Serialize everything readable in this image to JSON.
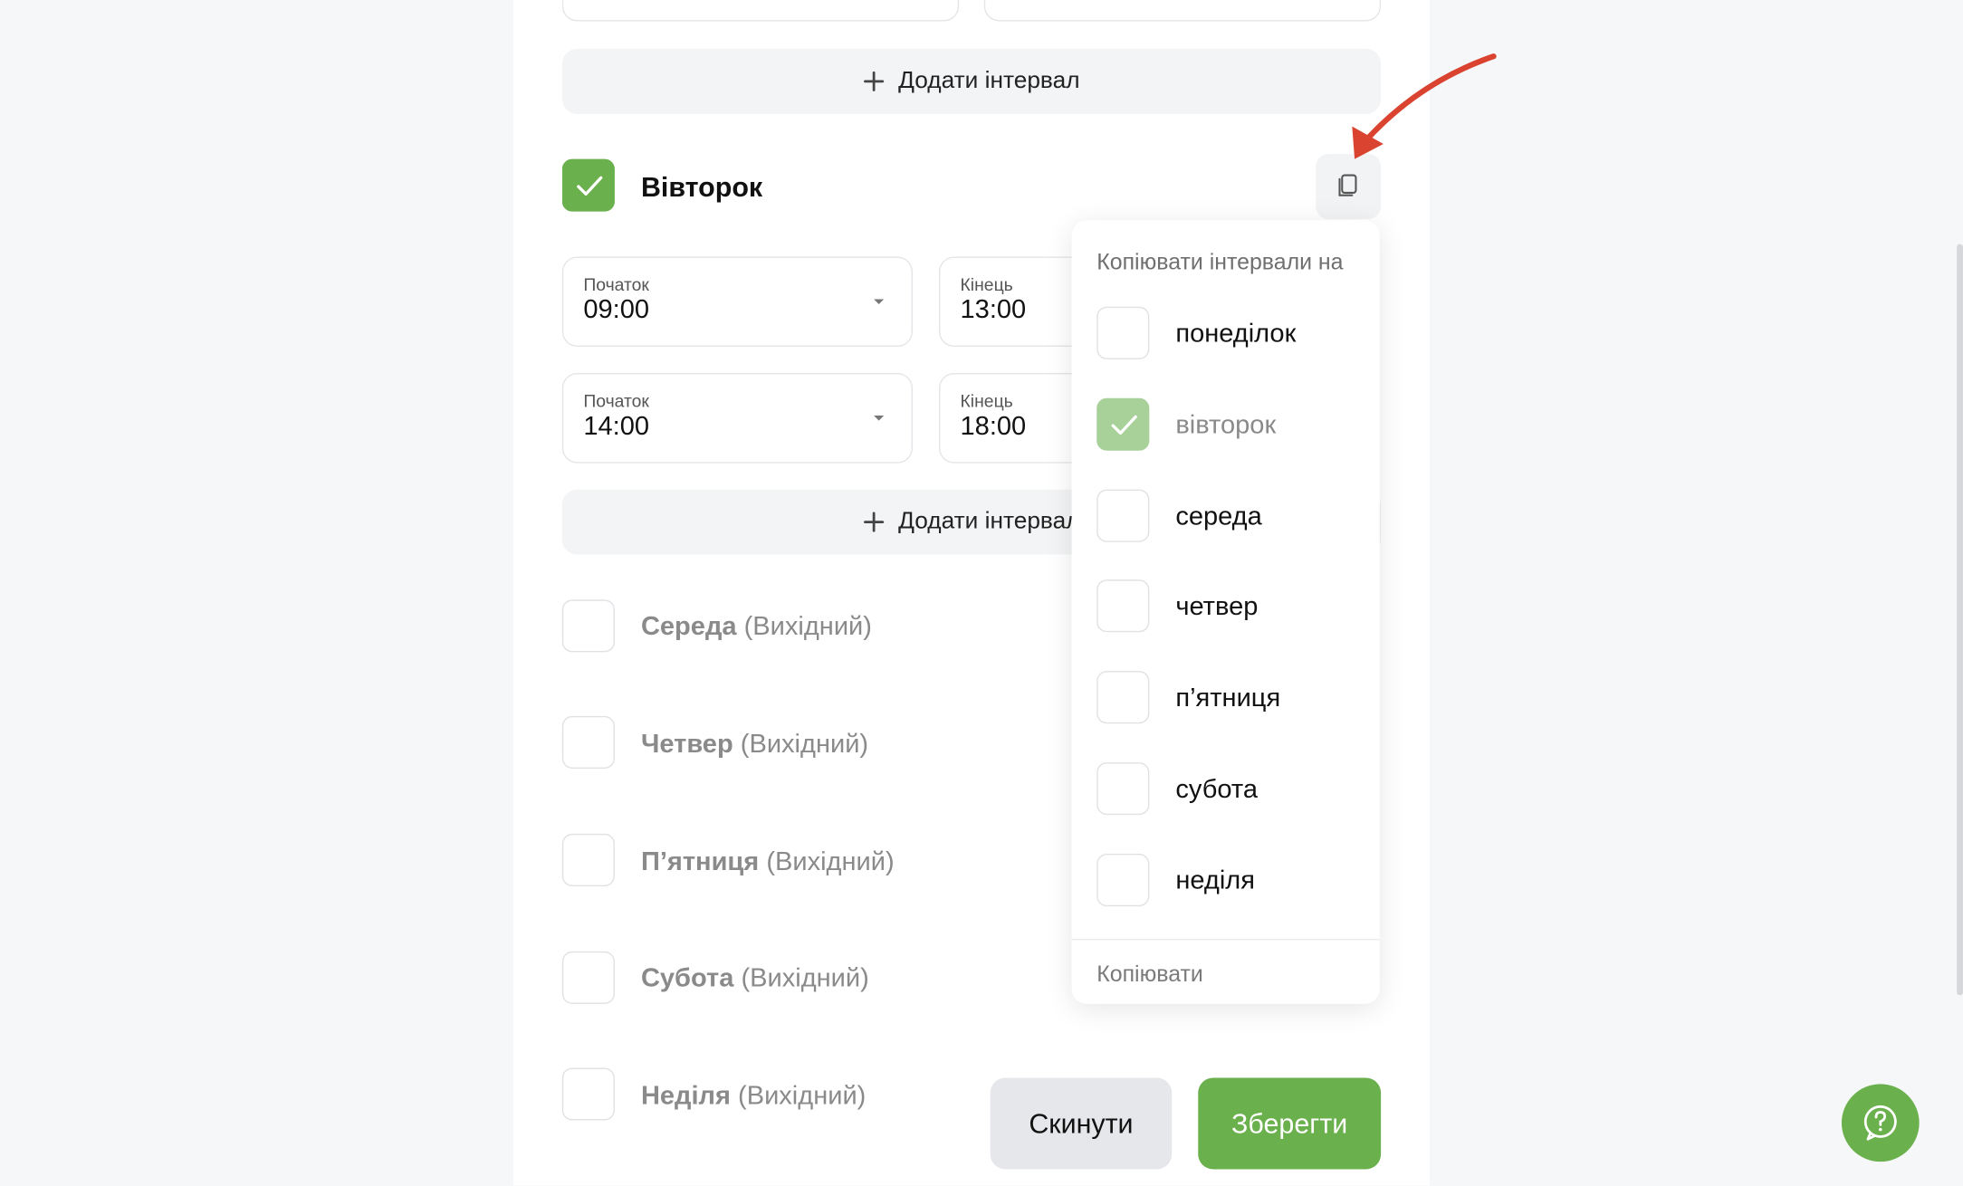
{
  "add_interval_label": "Додати інтервал",
  "tuesday": {
    "name": "Вівторок",
    "intervals": [
      {
        "start_label": "Початок",
        "start": "09:00",
        "end_label": "Кінець",
        "end": "13:00"
      },
      {
        "start_label": "Початок",
        "start": "14:00",
        "end_label": "Кінець",
        "end": "18:00"
      }
    ]
  },
  "off_days": [
    {
      "name": "Середа",
      "suffix": "(Вихідний)"
    },
    {
      "name": "Четвер",
      "suffix": "(Вихідний)"
    },
    {
      "name": "П’ятниця",
      "suffix": "(Вихідний)"
    },
    {
      "name": "Субота",
      "suffix": "(Вихідний)"
    },
    {
      "name": "Неділя",
      "suffix": "(Вихідний)"
    }
  ],
  "copy_dropdown": {
    "title": "Копіювати інтервали на",
    "days": [
      {
        "label": "понеділок",
        "checked": false
      },
      {
        "label": "вівторок",
        "checked": true,
        "disabled": true
      },
      {
        "label": "середа",
        "checked": false
      },
      {
        "label": "четвер",
        "checked": false
      },
      {
        "label": "п’ятниця",
        "checked": false
      },
      {
        "label": "субота",
        "checked": false
      },
      {
        "label": "неділя",
        "checked": false
      }
    ],
    "copy_label": "Копіювати"
  },
  "footer": {
    "reset_label": "Скинути",
    "save_label": "Зберегти"
  },
  "colors": {
    "accent": "#6ab04c",
    "arrow": "#d9432f"
  }
}
